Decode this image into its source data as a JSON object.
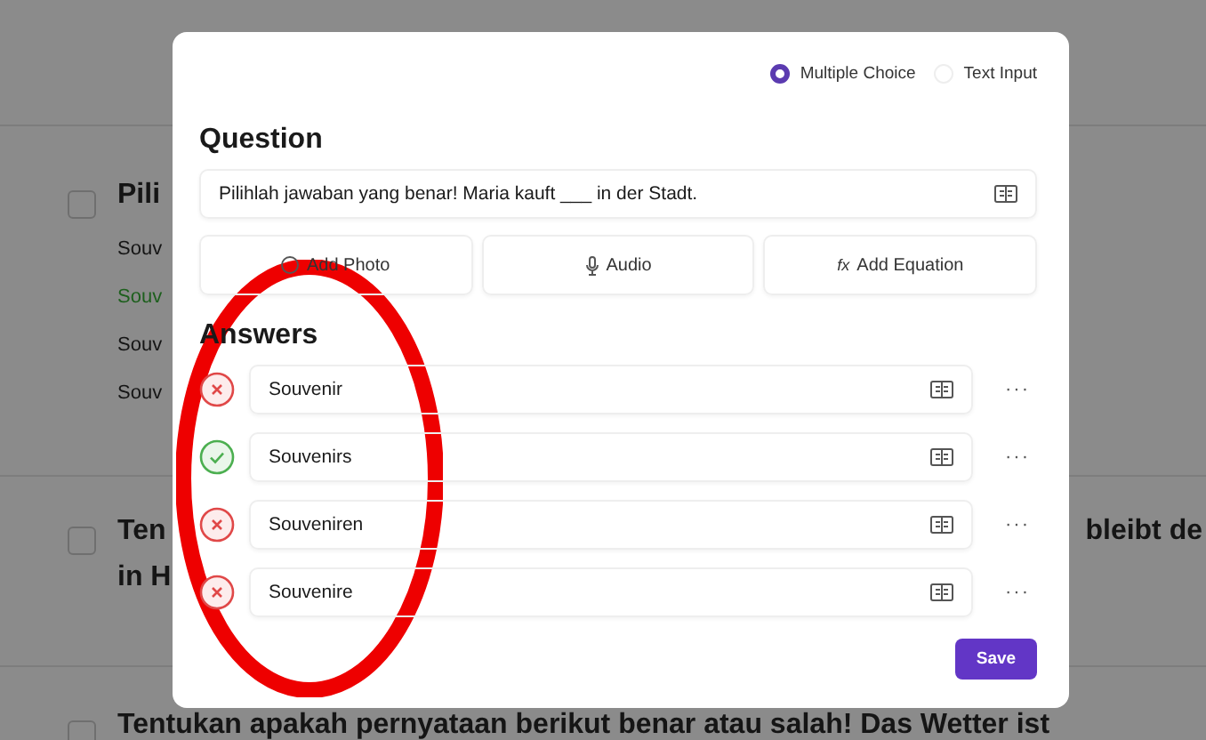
{
  "background_page": {
    "questions": [
      {
        "checkbox_checked": false,
        "title_parts": [
          "Pili"
        ],
        "options": [
          {
            "text": "Souv",
            "correct": false
          },
          {
            "text": "Souv",
            "correct": true
          },
          {
            "text": "Souv",
            "correct": false
          },
          {
            "text": "Souv",
            "correct": false
          }
        ]
      },
      {
        "checkbox_checked": false,
        "title_parts": [
          "Ten",
          "in H",
          "bleibt de"
        ]
      },
      {
        "checkbox_checked": false,
        "title_parts": [
          "Tentukan apakah pernyataan berikut benar atau salah! Das Wetter ist"
        ]
      }
    ]
  },
  "modal": {
    "question_types": [
      {
        "label": "Multiple Choice",
        "selected": true
      },
      {
        "label": "Text Input",
        "selected": false
      }
    ],
    "question_heading": "Question",
    "question_text": "Pilihlah jawaban yang benar!  Maria kauft ___ in der Stadt.",
    "media_buttons": [
      {
        "kind": "photo",
        "label": "Add Photo"
      },
      {
        "kind": "audio",
        "label": "Audio"
      },
      {
        "kind": "equation",
        "label": "Add Equation",
        "icon_text": "fx"
      }
    ],
    "answers_heading": "Answers",
    "answers": [
      {
        "text": "Souvenir",
        "correct": false
      },
      {
        "text": "Souvenirs",
        "correct": true
      },
      {
        "text": "Souveniren",
        "correct": false
      },
      {
        "text": "Souvenire",
        "correct": false
      }
    ],
    "more_label": "···",
    "save_label": "Save"
  }
}
